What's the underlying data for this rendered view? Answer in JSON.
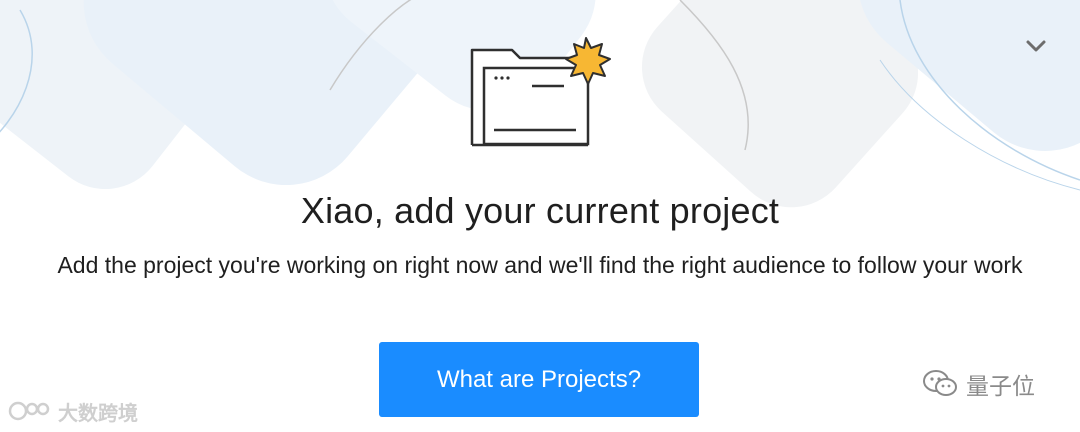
{
  "header": {
    "collapse_icon": "chevron-down-icon",
    "illustration_icon": "folder-with-burst-icon"
  },
  "main": {
    "title": "Xiao, add your current project",
    "subtitle": "Add the project you're working on right now and we'll find the right audience to follow your work",
    "cta_label": "What are Projects?"
  },
  "watermarks": {
    "left_text": "大数跨境",
    "right_text": "量子位"
  },
  "colors": {
    "accent": "#1a8cff",
    "burst": "#f7b733",
    "bg_shape": "#eaf1f8",
    "outline": "#b9d4ea"
  }
}
